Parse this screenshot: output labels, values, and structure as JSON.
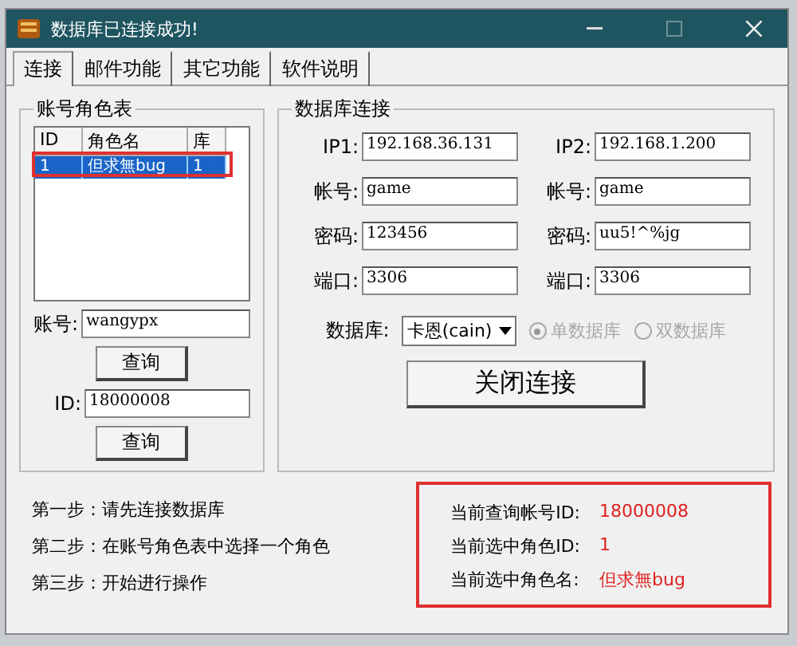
{
  "window": {
    "title": "数据库已连接成功!"
  },
  "tabs": [
    {
      "label": "连接",
      "selected": true
    },
    {
      "label": "邮件功能",
      "selected": false
    },
    {
      "label": "其它功能",
      "selected": false
    },
    {
      "label": "软件说明",
      "selected": false
    }
  ],
  "role_table": {
    "title": "账号角色表",
    "columns": [
      "ID",
      "角色名",
      "库"
    ],
    "rows": [
      {
        "cells": [
          "1",
          "但求無bug",
          "1"
        ],
        "selected": true,
        "highlighted": true
      }
    ]
  },
  "account_query": {
    "label": "账号:",
    "value": "wangypx",
    "button": "查询"
  },
  "id_query": {
    "label": "ID:",
    "value": "18000008",
    "button": "查询"
  },
  "db_connection": {
    "title": "数据库连接",
    "servers": [
      [
        {
          "label": "IP1:",
          "value": "192.168.36.131"
        },
        {
          "label": "帐号:",
          "value": "game"
        },
        {
          "label": "密码:",
          "value": "123456"
        },
        {
          "label": "端口:",
          "value": "3306"
        }
      ],
      [
        {
          "label": "IP2:",
          "value": "192.168.1.200"
        },
        {
          "label": "帐号:",
          "value": "game"
        },
        {
          "label": "密码:",
          "value": "uu5!^%jg"
        },
        {
          "label": "端口:",
          "value": "3306"
        }
      ]
    ],
    "database_label": "数据库:",
    "database_value": "卡恩(cain)",
    "modes": [
      {
        "label": "单数据库",
        "selected": true,
        "disabled": true
      },
      {
        "label": "双数据库",
        "selected": false,
        "disabled": true
      }
    ],
    "close_button": "关闭连接"
  },
  "steps": [
    "第一步：请先连接数据库",
    "第二步：在账号角色表中选择一个角色",
    "第三步：开始进行操作"
  ],
  "status": {
    "highlighted": true,
    "items": [
      {
        "label": "当前查询帐号ID:",
        "value": "18000008"
      },
      {
        "label": "当前选中角色ID:",
        "value": "1"
      },
      {
        "label": "当前选中角色名:",
        "value": "但求無bug"
      }
    ]
  }
}
